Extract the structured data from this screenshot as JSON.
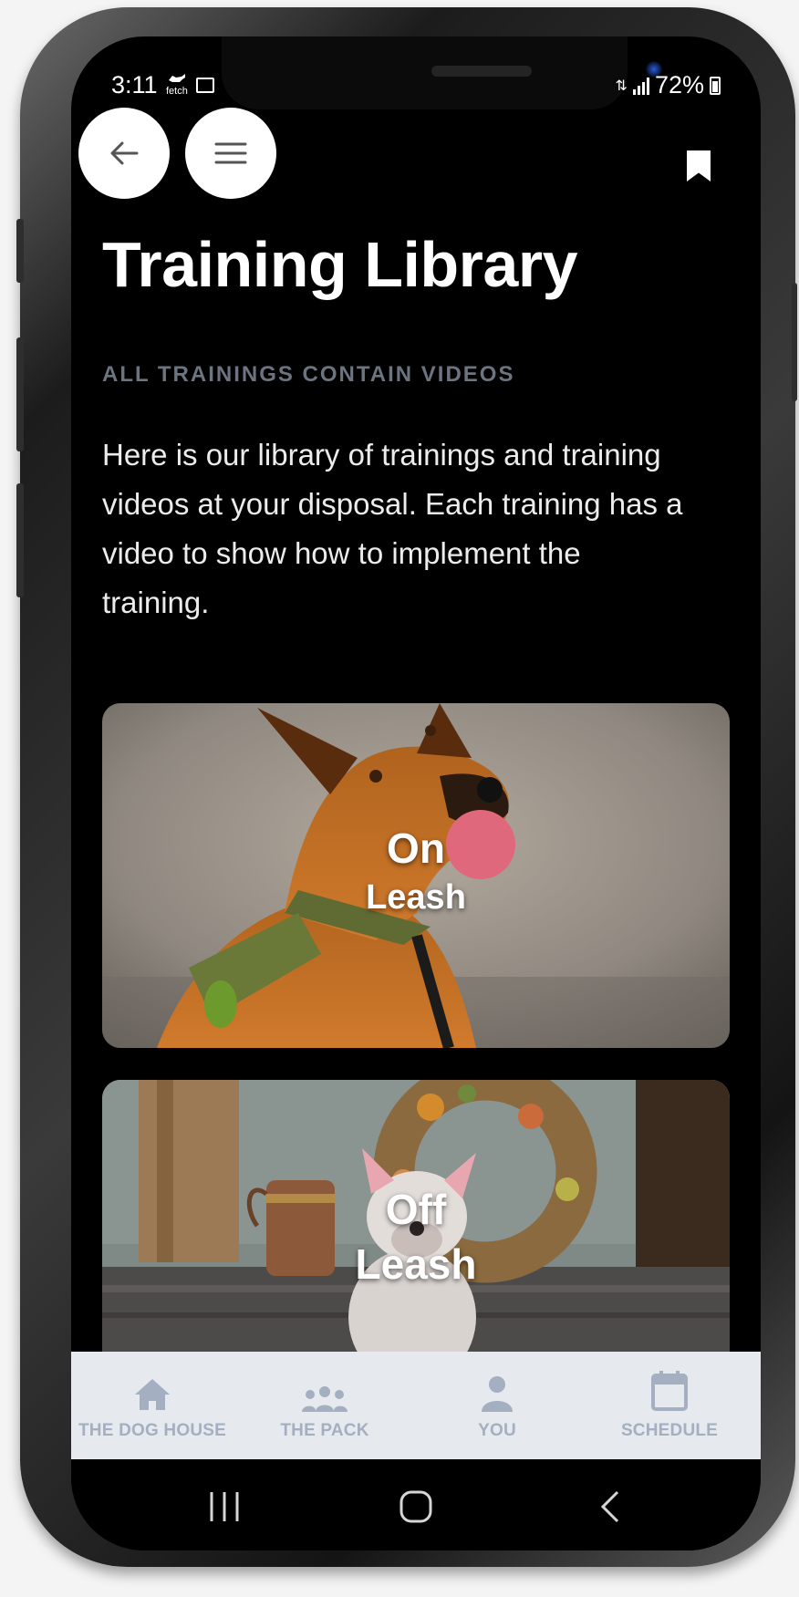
{
  "status_bar": {
    "time": "3:11",
    "notification_app": "fetch",
    "battery": "72%"
  },
  "header": {
    "title": "Training Library",
    "subtitle": "ALL TRAININGS CONTAIN VIDEOS",
    "description": "Here is our library of trainings and training videos at your disposal. Each training has a video to show how to implement the training."
  },
  "trainings": [
    {
      "line1": "On",
      "line2": "Leash",
      "image": "brown-shepherd-dog-photo"
    },
    {
      "line1": "Off",
      "line2": "Leash",
      "image": "white-bulldog-photo"
    }
  ],
  "bottom_nav": [
    {
      "label": "THE DOG HOUSE",
      "icon": "home-icon"
    },
    {
      "label": "THE PACK",
      "icon": "group-icon"
    },
    {
      "label": "YOU",
      "icon": "user-icon"
    },
    {
      "label": "SCHEDULE",
      "icon": "calendar-icon"
    }
  ],
  "colors": {
    "background": "#000000",
    "subtitle": "#6b7480",
    "nav_background": "#e6e9ed",
    "nav_inactive": "#a4b0c2"
  }
}
